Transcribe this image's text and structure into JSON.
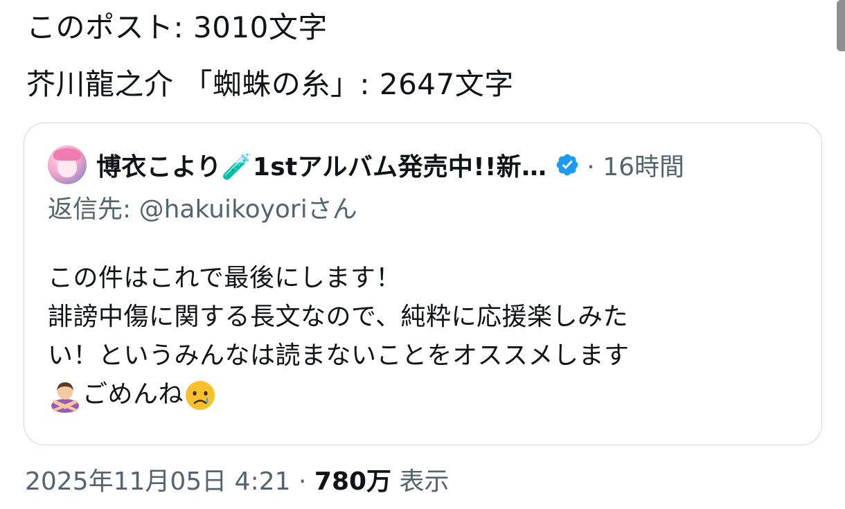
{
  "post": {
    "lines": [
      "このポスト: 3010文字",
      "芥川龍之介 「蜘蛛の糸」: 2647文字"
    ]
  },
  "quote": {
    "author_name": "博衣こより🧪1stアルバム発売中!!新…",
    "time_prefix": "·",
    "time": "16時間",
    "reply_to": "返信先: @hakuikoyoriさん",
    "body_lines": [
      "この件はこれで最後にします！",
      "誹謗中傷に関する長文なので、純粋に応援楽しみた",
      "い！というみんなは読まないことをオススメします",
      "ごめんね"
    ],
    "icons": {
      "verified": "verified-badge-icon",
      "gesture": "person-gesturing-no-emoji",
      "crying": "crying-face-emoji"
    }
  },
  "meta": {
    "datetime": "2025年11月05日 4:21",
    "separator": "·",
    "views_count": "780万",
    "views_label": "表示"
  },
  "colors": {
    "text": "#0f1419",
    "secondary": "#536471",
    "border": "#cfd9de",
    "verified": "#1d9bf0"
  }
}
